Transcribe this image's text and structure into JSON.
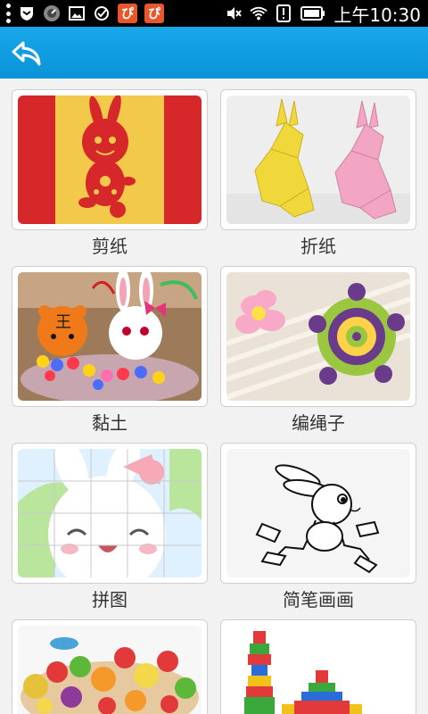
{
  "status_bar": {
    "time": "上午10:30",
    "app_badge_1": "ぴ",
    "app_badge_2": "ぴ"
  },
  "header": {
    "back_icon": "back-arrow-icon"
  },
  "crafts": [
    {
      "label": "剪纸"
    },
    {
      "label": "折纸"
    },
    {
      "label": "黏土"
    },
    {
      "label": "编绳子"
    },
    {
      "label": "拼图"
    },
    {
      "label": "简笔画画"
    }
  ]
}
